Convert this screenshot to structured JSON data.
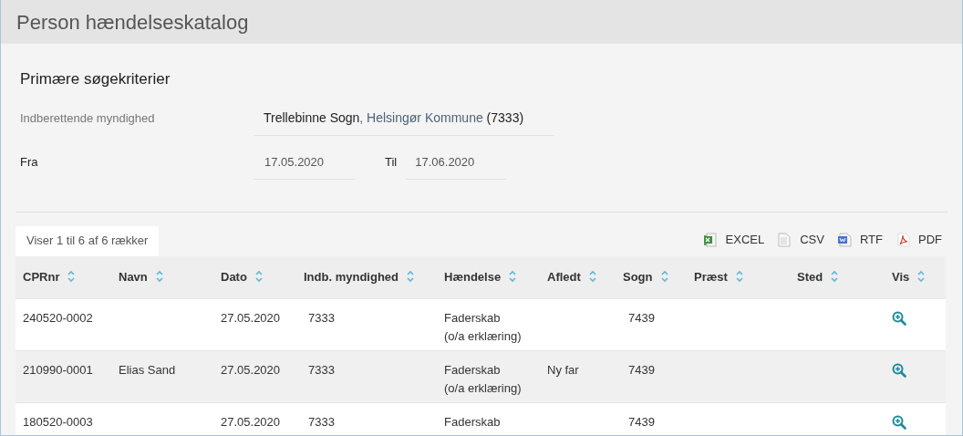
{
  "page": {
    "title": "Person hændelseskatalog"
  },
  "criteria": {
    "heading": "Primære søgekriterier",
    "authority": {
      "label": "Indberettende myndighed",
      "value_parts": [
        "Trellebinne Sogn",
        ", Helsingør Kommune",
        " (7333)"
      ]
    },
    "from": {
      "label": "Fra",
      "value": "17.05.2020"
    },
    "to": {
      "label": "Til",
      "value": "17.06.2020"
    }
  },
  "table_info": "Viser 1 til 6 af 6 rækker",
  "exports": [
    {
      "kind": "excel",
      "label": "EXCEL"
    },
    {
      "kind": "csv",
      "label": "CSV"
    },
    {
      "kind": "rtf",
      "label": "RTF"
    },
    {
      "kind": "pdf",
      "label": "PDF"
    }
  ],
  "table": {
    "columns": [
      "CPRnr",
      "Navn",
      "Dato",
      "Indb. myndighed",
      "Hændelse",
      "Afledt",
      "Sogn",
      "Præst",
      "Sted",
      "Vis"
    ],
    "rows": [
      {
        "cprnr": "240520-0002",
        "navn": "",
        "dato": "27.05.2020",
        "myndighed": "7333",
        "haendelse": [
          "Faderskab",
          "(o/a erklæring)"
        ],
        "afledt": "",
        "sogn": "7439"
      },
      {
        "cprnr": "210990-0001",
        "navn": "Elias Sand",
        "dato": "27.05.2020",
        "myndighed": "7333",
        "haendelse": [
          "Faderskab",
          "(o/a erklæring)"
        ],
        "afledt": "Ny far",
        "sogn": "7439"
      },
      {
        "cprnr": "180520-0003",
        "navn": "",
        "dato": "27.05.2020",
        "myndighed": "7333",
        "haendelse": [
          "Faderskab"
        ],
        "afledt": "",
        "sogn": "7439"
      }
    ]
  }
}
